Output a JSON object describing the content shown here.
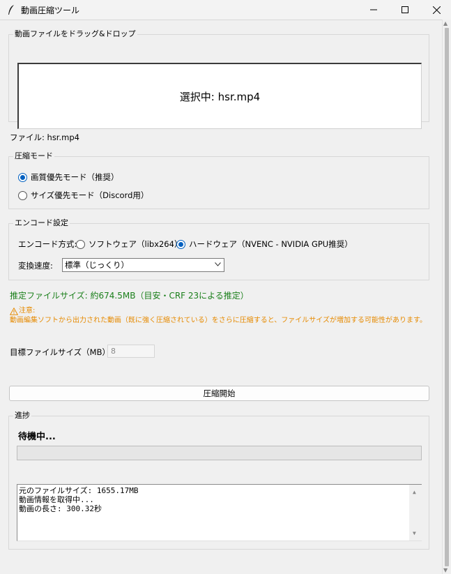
{
  "window": {
    "title": "動画圧縮ツール"
  },
  "drop": {
    "group_label": "動画ファイルをドラッグ&ドロップ",
    "selected_text": "選択中: hsr.mp4"
  },
  "file_label": "ファイル: hsr.mp4",
  "mode": {
    "group_label": "圧縮モード",
    "options": [
      {
        "label": "画質優先モード（推奨）",
        "selected": true
      },
      {
        "label": "サイズ優先モード（Discord用）",
        "selected": false
      }
    ]
  },
  "encode": {
    "group_label": "エンコード設定",
    "method_label": "エンコード方式:",
    "methods": [
      {
        "label": "ソフトウェア（libx264）",
        "selected": false
      },
      {
        "label": "ハードウェア（NVENC - NVIDIA GPU推奨）",
        "selected": true
      }
    ],
    "speed_label": "変換速度:",
    "speed_value": "標準（じっくり）"
  },
  "estimate_text": "推定ファイルサイズ: 約674.5MB（目安・CRF 23による推定）",
  "warning": {
    "title": "注意:",
    "body": "動画編集ソフトから出力された動画（既に強く圧縮されている）をさらに圧縮すると、ファイルサイズが増加する可能性があります。"
  },
  "target": {
    "label": "目標ファイルサイズ（MB）：",
    "value": "8"
  },
  "start_button": "圧縮開始",
  "progress": {
    "group_label": "進捗",
    "status": "待機中...",
    "fraction": 0,
    "log": [
      "元のファイルサイズ: 1655.17MB",
      "動画情報を取得中...",
      "動画の長さ: 300.32秒"
    ]
  },
  "colors": {
    "estimate": "#1a7f1a",
    "warning": "#e68a00",
    "radio_selected": "#0060c0"
  }
}
